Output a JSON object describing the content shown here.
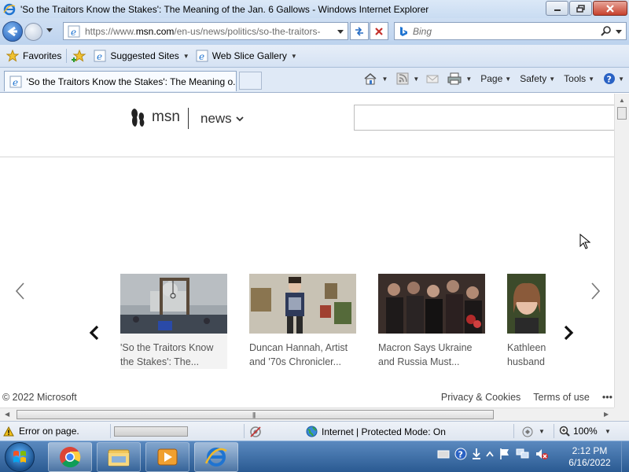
{
  "window": {
    "title": "'So the Traitors Know the Stakes': The Meaning of the Jan. 6 Gallows - Windows Internet Explorer"
  },
  "address": {
    "url_prefix": "https://www.",
    "url_domain": "msn.com",
    "url_path": "/en-us/news/politics/so-the-traitors-",
    "search_placeholder": "Bing"
  },
  "favorites_bar": {
    "favorites_label": "Favorites",
    "suggested_sites_label": "Suggested Sites",
    "web_slice_label": "Web Slice Gallery"
  },
  "tab": {
    "title": "'So the Traitors Know the Stakes': The Meaning o..."
  },
  "command_bar": {
    "page_label": "Page",
    "safety_label": "Safety",
    "tools_label": "Tools"
  },
  "msn": {
    "logo_text": "msn",
    "section_label": "news",
    "search_value": ""
  },
  "carousel": {
    "cards": [
      {
        "caption": "'So the Traitors Know the Stakes': The..."
      },
      {
        "caption": "Duncan Hannah, Artist and '70s Chronicler..."
      },
      {
        "caption": "Macron Says Ukraine and Russia Must..."
      },
      {
        "caption": "Kathleen husband"
      }
    ]
  },
  "footer": {
    "copyright": "© 2022 Microsoft",
    "privacy": "Privacy & Cookies",
    "terms": "Terms of use",
    "more": "•••"
  },
  "status": {
    "error_text": "Error on page.",
    "zone_text": "Internet | Protected Mode: On",
    "zoom_text": "100%"
  },
  "taskbar": {
    "time": "2:12 PM",
    "date": "6/16/2022"
  },
  "colors": {
    "ie_chrome": "#cfdff3",
    "taskbar": "#2a5a92",
    "link_text": "#555555"
  }
}
